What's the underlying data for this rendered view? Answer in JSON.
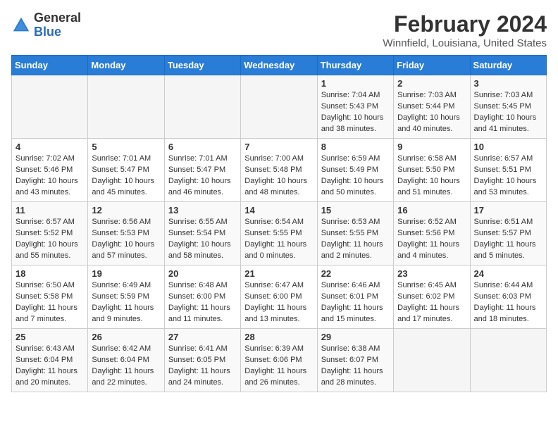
{
  "header": {
    "logo_line1": "General",
    "logo_line2": "Blue",
    "month_year": "February 2024",
    "location": "Winnfield, Louisiana, United States"
  },
  "weekdays": [
    "Sunday",
    "Monday",
    "Tuesday",
    "Wednesday",
    "Thursday",
    "Friday",
    "Saturday"
  ],
  "weeks": [
    [
      {
        "day": "",
        "info": ""
      },
      {
        "day": "",
        "info": ""
      },
      {
        "day": "",
        "info": ""
      },
      {
        "day": "",
        "info": ""
      },
      {
        "day": "1",
        "info": "Sunrise: 7:04 AM\nSunset: 5:43 PM\nDaylight: 10 hours\nand 38 minutes."
      },
      {
        "day": "2",
        "info": "Sunrise: 7:03 AM\nSunset: 5:44 PM\nDaylight: 10 hours\nand 40 minutes."
      },
      {
        "day": "3",
        "info": "Sunrise: 7:03 AM\nSunset: 5:45 PM\nDaylight: 10 hours\nand 41 minutes."
      }
    ],
    [
      {
        "day": "4",
        "info": "Sunrise: 7:02 AM\nSunset: 5:46 PM\nDaylight: 10 hours\nand 43 minutes."
      },
      {
        "day": "5",
        "info": "Sunrise: 7:01 AM\nSunset: 5:47 PM\nDaylight: 10 hours\nand 45 minutes."
      },
      {
        "day": "6",
        "info": "Sunrise: 7:01 AM\nSunset: 5:47 PM\nDaylight: 10 hours\nand 46 minutes."
      },
      {
        "day": "7",
        "info": "Sunrise: 7:00 AM\nSunset: 5:48 PM\nDaylight: 10 hours\nand 48 minutes."
      },
      {
        "day": "8",
        "info": "Sunrise: 6:59 AM\nSunset: 5:49 PM\nDaylight: 10 hours\nand 50 minutes."
      },
      {
        "day": "9",
        "info": "Sunrise: 6:58 AM\nSunset: 5:50 PM\nDaylight: 10 hours\nand 51 minutes."
      },
      {
        "day": "10",
        "info": "Sunrise: 6:57 AM\nSunset: 5:51 PM\nDaylight: 10 hours\nand 53 minutes."
      }
    ],
    [
      {
        "day": "11",
        "info": "Sunrise: 6:57 AM\nSunset: 5:52 PM\nDaylight: 10 hours\nand 55 minutes."
      },
      {
        "day": "12",
        "info": "Sunrise: 6:56 AM\nSunset: 5:53 PM\nDaylight: 10 hours\nand 57 minutes."
      },
      {
        "day": "13",
        "info": "Sunrise: 6:55 AM\nSunset: 5:54 PM\nDaylight: 10 hours\nand 58 minutes."
      },
      {
        "day": "14",
        "info": "Sunrise: 6:54 AM\nSunset: 5:55 PM\nDaylight: 11 hours\nand 0 minutes."
      },
      {
        "day": "15",
        "info": "Sunrise: 6:53 AM\nSunset: 5:55 PM\nDaylight: 11 hours\nand 2 minutes."
      },
      {
        "day": "16",
        "info": "Sunrise: 6:52 AM\nSunset: 5:56 PM\nDaylight: 11 hours\nand 4 minutes."
      },
      {
        "day": "17",
        "info": "Sunrise: 6:51 AM\nSunset: 5:57 PM\nDaylight: 11 hours\nand 5 minutes."
      }
    ],
    [
      {
        "day": "18",
        "info": "Sunrise: 6:50 AM\nSunset: 5:58 PM\nDaylight: 11 hours\nand 7 minutes."
      },
      {
        "day": "19",
        "info": "Sunrise: 6:49 AM\nSunset: 5:59 PM\nDaylight: 11 hours\nand 9 minutes."
      },
      {
        "day": "20",
        "info": "Sunrise: 6:48 AM\nSunset: 6:00 PM\nDaylight: 11 hours\nand 11 minutes."
      },
      {
        "day": "21",
        "info": "Sunrise: 6:47 AM\nSunset: 6:00 PM\nDaylight: 11 hours\nand 13 minutes."
      },
      {
        "day": "22",
        "info": "Sunrise: 6:46 AM\nSunset: 6:01 PM\nDaylight: 11 hours\nand 15 minutes."
      },
      {
        "day": "23",
        "info": "Sunrise: 6:45 AM\nSunset: 6:02 PM\nDaylight: 11 hours\nand 17 minutes."
      },
      {
        "day": "24",
        "info": "Sunrise: 6:44 AM\nSunset: 6:03 PM\nDaylight: 11 hours\nand 18 minutes."
      }
    ],
    [
      {
        "day": "25",
        "info": "Sunrise: 6:43 AM\nSunset: 6:04 PM\nDaylight: 11 hours\nand 20 minutes."
      },
      {
        "day": "26",
        "info": "Sunrise: 6:42 AM\nSunset: 6:04 PM\nDaylight: 11 hours\nand 22 minutes."
      },
      {
        "day": "27",
        "info": "Sunrise: 6:41 AM\nSunset: 6:05 PM\nDaylight: 11 hours\nand 24 minutes."
      },
      {
        "day": "28",
        "info": "Sunrise: 6:39 AM\nSunset: 6:06 PM\nDaylight: 11 hours\nand 26 minutes."
      },
      {
        "day": "29",
        "info": "Sunrise: 6:38 AM\nSunset: 6:07 PM\nDaylight: 11 hours\nand 28 minutes."
      },
      {
        "day": "",
        "info": ""
      },
      {
        "day": "",
        "info": ""
      }
    ]
  ]
}
